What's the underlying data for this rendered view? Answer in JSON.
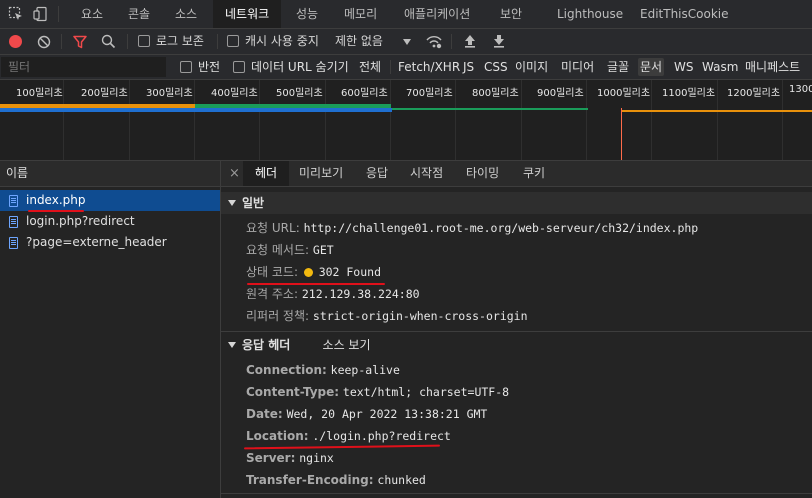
{
  "tabs": [
    {
      "label": "요소"
    },
    {
      "label": "콘솔"
    },
    {
      "label": "소스"
    },
    {
      "label": "네트워크"
    },
    {
      "label": "성능"
    },
    {
      "label": "메모리"
    },
    {
      "label": "애플리케이션"
    },
    {
      "label": "보안"
    },
    {
      "label": "Lighthouse"
    },
    {
      "label": "EditThisCookie"
    }
  ],
  "toolbar": {
    "preserve_log": "로그 보존",
    "disable_cache": "캐시 사용 중지",
    "throttling": "제한 없음"
  },
  "filter": {
    "placeholder": "필터",
    "invert": "반전",
    "hide_data_urls": "데이터 URL 숨기기",
    "types": [
      "전체",
      "Fetch/XHR",
      "JS",
      "CSS",
      "이미지",
      "미디어",
      "글꼴",
      "문서",
      "WS",
      "Wasm",
      "매니페스트"
    ],
    "selected_type": "문서"
  },
  "overview": {
    "ticks": [
      "100밀리초",
      "200밀리초",
      "300밀리초",
      "400밀리초",
      "500밀리초",
      "600밀리초",
      "700밀리초",
      "800밀리초",
      "900밀리초",
      "1000밀리초",
      "1100밀리초",
      "1200밀리초",
      "1300"
    ],
    "colors": {
      "orange": "#e8910c",
      "green": "#1a9c5a",
      "blue": "#1f6fd0",
      "red_marker": "#ff6b4a"
    }
  },
  "requests": {
    "header": "이름",
    "items": [
      {
        "name": "index.php"
      },
      {
        "name": "login.php?redirect"
      },
      {
        "name": "?page=externe_header"
      }
    ]
  },
  "detail_tabs": [
    "헤더",
    "미리보기",
    "응답",
    "시작점",
    "타이밍",
    "쿠키"
  ],
  "general": {
    "title": "일반",
    "rows": [
      {
        "key": "요청 URL:",
        "value": "http://challenge01.root-me.org/web-serveur/ch32/index.php"
      },
      {
        "key": "요청 메서드:",
        "value": "GET"
      },
      {
        "key": "상태 코드:",
        "value": "302 Found"
      },
      {
        "key": "원격 주소:",
        "value": "212.129.38.224:80"
      },
      {
        "key": "리퍼러 정책:",
        "value": "strict-origin-when-cross-origin"
      }
    ],
    "status_color": "#f2b90f"
  },
  "response_headers": {
    "title": "응답 헤더",
    "view_source": "소스 보기",
    "rows": [
      {
        "key": "Connection:",
        "value": "keep-alive"
      },
      {
        "key": "Content-Type:",
        "value": "text/html; charset=UTF-8"
      },
      {
        "key": "Date:",
        "value": "Wed, 20 Apr 2022 13:38:21 GMT"
      },
      {
        "key": "Location:",
        "value": "./login.php?redirect"
      },
      {
        "key": "Server:",
        "value": "nginx"
      },
      {
        "key": "Transfer-Encoding:",
        "value": "chunked"
      }
    ]
  }
}
